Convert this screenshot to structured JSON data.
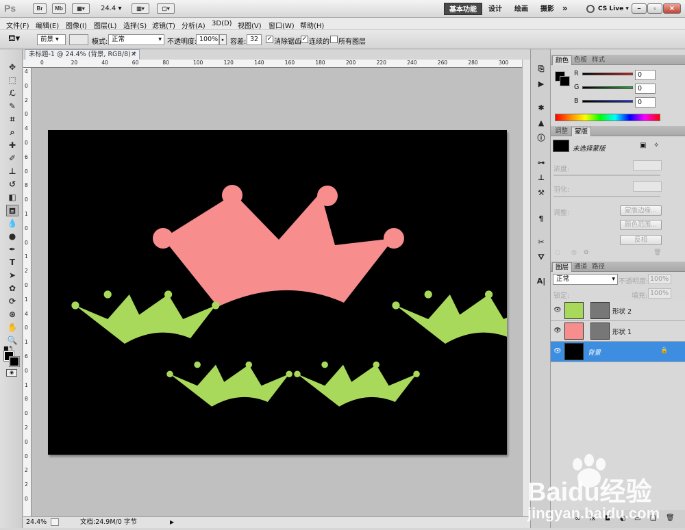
{
  "titlebar": {
    "app_logo": "Ps",
    "br_label": "Br",
    "mb_label": "Mb",
    "zoom": "24.4",
    "workspaces": [
      "基本功能",
      "设计",
      "绘画",
      "摄影"
    ],
    "more": "»",
    "cslive": "CS Live",
    "win_min": "–",
    "win_max": "▫",
    "win_close": "✕"
  },
  "menu": [
    "文件(F)",
    "编辑(E)",
    "图像(I)",
    "图层(L)",
    "选择(S)",
    "滤镜(T)",
    "分析(A)",
    "3D(D)",
    "视图(V)",
    "窗口(W)",
    "帮助(H)"
  ],
  "options": {
    "fill_source": "前景",
    "mode_label": "模式:",
    "mode_value": "正常",
    "opacity_label": "不透明度:",
    "opacity_value": "100%",
    "tolerance_label": "容差:",
    "tolerance_value": "32",
    "antialias_label": "消除锯齿",
    "contiguous_label": "连续的",
    "all_layers_label": "所有图层",
    "check_mark": "✓"
  },
  "document": {
    "tab_title": "未标题-1 @ 24.4% (背景, RGB/8) *",
    "tab_close": "✕",
    "ruler_h": [
      "0",
      "20",
      "40",
      "60",
      "80",
      "100",
      "120",
      "140",
      "160",
      "180",
      "200",
      "220",
      "240",
      "260",
      "280",
      "300"
    ],
    "ruler_v": [
      "4",
      "0",
      "2",
      "0",
      "4",
      "0",
      "6",
      "0",
      "8",
      "0",
      "1",
      "0",
      "0",
      "1",
      "2",
      "0",
      "1",
      "4",
      "0",
      "1",
      "6",
      "0",
      "1",
      "8",
      "0",
      "2",
      "0",
      "0",
      "2",
      "2",
      "0"
    ],
    "background_color": "#000000",
    "crown_big_color": "#f78d8d",
    "crown_small_color": "#a9d95a"
  },
  "status": {
    "zoom": "24.4%",
    "doc_info": "文档:24.9M/0 字节",
    "arrow": "▶"
  },
  "color_panel": {
    "tabs": [
      "颜色",
      "色板",
      "样式"
    ],
    "channels": [
      {
        "label": "R",
        "value": "0",
        "color": "#d01818"
      },
      {
        "label": "G",
        "value": "0",
        "color": "#19b028"
      },
      {
        "label": "B",
        "value": "0",
        "color": "#1b2fd6"
      }
    ]
  },
  "mask_panel": {
    "tabs": [
      "调整",
      "蒙版"
    ],
    "title": "未选择蒙版",
    "density_label": "浓度:",
    "feather_label": "羽化:",
    "adjust_label": "调整:",
    "btn_edge": "蒙版边缘...",
    "btn_range": "颜色范围...",
    "btn_invert": "反相"
  },
  "layers_panel": {
    "tabs": [
      "图层",
      "通道",
      "路径"
    ],
    "blend_mode": "正常",
    "opacity_label": "不透明度:",
    "opacity_value": "100%",
    "lock_label": "锁定:",
    "fill_label": "填充:",
    "fill_value": "100%",
    "layers": [
      {
        "name": "形状 2",
        "thumb_color": "#a9d95a",
        "selected": false
      },
      {
        "name": "形状 1",
        "thumb_color": "#f78d8d",
        "selected": false
      },
      {
        "name": "背景",
        "thumb_color": "#000000",
        "selected": true
      }
    ],
    "bottom_icons": [
      "∞",
      "fx",
      "◘",
      "◐",
      "▭",
      "❏",
      "🗑"
    ]
  },
  "watermark": {
    "brand": "Baidu经验",
    "url": "jingyan.baidu.com"
  }
}
